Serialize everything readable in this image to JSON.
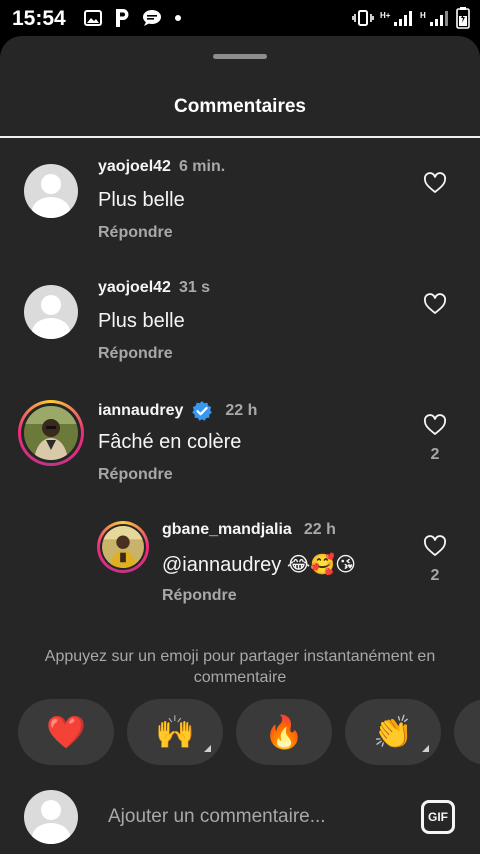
{
  "status_bar": {
    "time": "15:54",
    "left_icons": [
      "image-icon",
      "p-app-icon",
      "chat-bubble-icon",
      "dot-icon"
    ],
    "right_icons": [
      "vibrate-icon",
      "signal-h-plus-icon",
      "signal-h-icon",
      "battery-icon"
    ]
  },
  "sheet": {
    "title": "Commentaires"
  },
  "comments": [
    {
      "username": "yaojoel42",
      "time": "6 min.",
      "text": "Plus belle",
      "reply_label": "Répondre",
      "likes": "",
      "verified": false,
      "avatar": "default-avatar"
    },
    {
      "username": "yaojoel42",
      "time": "31 s",
      "text": "Plus belle",
      "reply_label": "Répondre",
      "likes": "",
      "verified": false,
      "avatar": "default-avatar"
    },
    {
      "username": "iannaudrey",
      "time": "22 h",
      "text": "Fâché en colère",
      "reply_label": "Répondre",
      "likes": "2",
      "verified": true,
      "avatar": "story-avatar"
    },
    {
      "username": "gbane_mandjalia",
      "time": "22 h",
      "text": "@iannaudrey 😂🥰😘",
      "reply_label": "Répondre",
      "likes": "2",
      "verified": false,
      "avatar": "story-avatar",
      "is_reply": true
    }
  ],
  "emoji_bar": {
    "hint": "Appuyez sur un emoji pour partager instantanément en commentaire",
    "emojis": [
      "❤️",
      "🙌",
      "🔥",
      "👏"
    ]
  },
  "composer": {
    "placeholder": "Ajouter un commentaire...",
    "gif_label": "GIF"
  },
  "colors": {
    "sheet_bg": "#262626",
    "text_primary": "#f5f5f5",
    "text_secondary": "#a8a8a8",
    "verified_blue": "#3897f0",
    "pill_bg": "#3a3a3a"
  }
}
